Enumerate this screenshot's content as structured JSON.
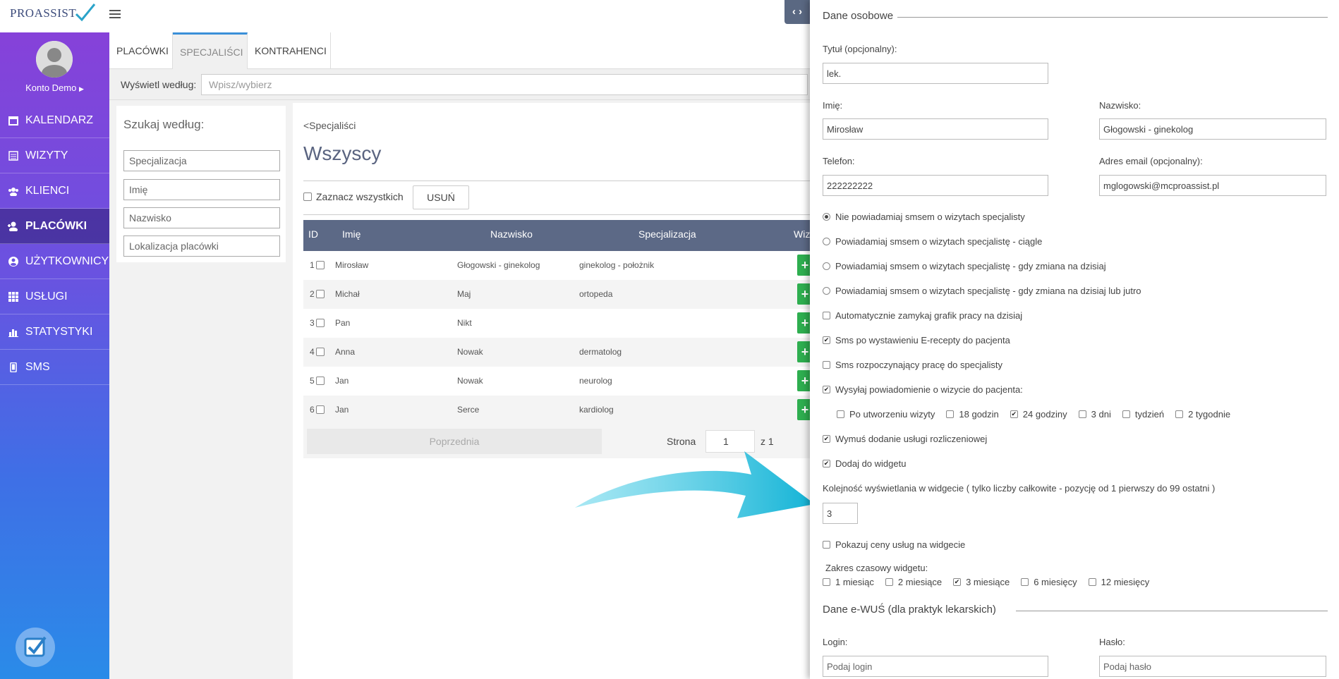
{
  "app": {
    "logo_text": "PROASSIST",
    "account_name": "Konto Demo"
  },
  "sidebar": {
    "items": [
      {
        "label": "KALENDARZ",
        "icon": "calendar-icon"
      },
      {
        "label": "WIZYTY",
        "icon": "list-icon"
      },
      {
        "label": "KLIENCI",
        "icon": "users-icon"
      },
      {
        "label": "PLACÓWKI",
        "icon": "user-plus-icon",
        "active": true
      },
      {
        "label": "UŻYTKOWNICY",
        "icon": "user-circle-icon"
      },
      {
        "label": "USŁUGI",
        "icon": "grid-icon"
      },
      {
        "label": "STATYSTYKI",
        "icon": "bar-chart-icon"
      },
      {
        "label": "SMS",
        "icon": "mobile-icon"
      }
    ]
  },
  "tabs": [
    "PLACÓWKI",
    "SPECJALIŚCI",
    "KONTRAHENCI"
  ],
  "filter": {
    "label": "Wyświetl według:",
    "placeholder": "Wpisz/wybierz"
  },
  "search": {
    "title": "Szukaj według:",
    "fields": [
      "Specjalizacja",
      "Imię",
      "Nazwisko",
      "Lokalizacja placówki"
    ]
  },
  "main": {
    "back_link": "<Specjaliści",
    "title": "Wszyscy",
    "select_all": "Zaznacz wszystkich",
    "delete_button": "USUŃ"
  },
  "table": {
    "columns": [
      "ID",
      "Imię",
      "Nazwisko",
      "Specjalizacja",
      "Wiz"
    ],
    "rows": [
      {
        "id": "1",
        "first": "Mirosław",
        "last": "Głogowski - ginekolog",
        "spec": "ginekolog - położnik"
      },
      {
        "id": "2",
        "first": "Michał",
        "last": "Maj",
        "spec": "ortopeda"
      },
      {
        "id": "3",
        "first": "Pan",
        "last": "Nikt",
        "spec": ""
      },
      {
        "id": "4",
        "first": "Anna",
        "last": "Nowak",
        "spec": "dermatolog"
      },
      {
        "id": "5",
        "first": "Jan",
        "last": "Nowak",
        "spec": "neurolog"
      },
      {
        "id": "6",
        "first": "Jan",
        "last": "Serce",
        "spec": "kardiolog"
      }
    ],
    "add_label": "+"
  },
  "pager": {
    "prev": "Poprzednia",
    "page_label": "Strona",
    "page_value": "1",
    "of": "z 1"
  },
  "panel": {
    "personal_title": "Dane osobowe",
    "title_label": "Tytuł (opcjonalny):",
    "title_value": "lek.",
    "first_label": "Imię:",
    "first_value": "Mirosław",
    "last_label": "Nazwisko:",
    "last_value": "Głogowski - ginekolog",
    "phone_label": "Telefon:",
    "phone_value": "222222222",
    "email_label": "Adres email (opcjonalny):",
    "email_value": "mglogowski@mcproassist.pl",
    "radios": [
      "Nie powiadamiaj smsem o wizytach specjalisty",
      "Powiadamiaj smsem o wizytach specjalistę - ciągle",
      "Powiadamiaj smsem o wizytach specjalistę - gdy zmiana na dzisiaj",
      "Powiadamiaj smsem o wizytach specjalistę - gdy zmiana na dzisiaj lub jutro"
    ],
    "check_autoclose": "Automatycznie zamykaj grafik pracy na dzisiaj",
    "check_erecepta": "Sms po wystawieniu E-recepty do pacjenta",
    "check_start": "Sms rozpoczynający pracę do specjalisty",
    "check_notify": "Wysyłaj powiadomienie o wizycie do pacjenta:",
    "notify_opts": [
      "Po utworzeniu wizyty",
      "18 godzin",
      "24 godziny",
      "3 dni",
      "tydzień",
      "2 tygodnie"
    ],
    "check_force": "Wymuś dodanie usługi rozliczeniowej",
    "check_widget": "Dodaj do widgetu",
    "order_label": "Kolejność wyświetlania w widgecie ( tylko liczby całkowite - pozycję od 1 pierwszy do 99 ostatni )",
    "order_value": "3",
    "check_prices": "Pokazuj ceny usług na widgecie",
    "range_label": "Zakres czasowy widgetu:",
    "range_opts": [
      "1 miesiąc",
      "2 miesiące",
      "3 miesiące",
      "6 miesięcy",
      "12 miesięcy"
    ],
    "ewus_title": "Dane e-WUŚ (dla praktyk lekarskich)",
    "login_label": "Login:",
    "login_placeholder": "Podaj login",
    "pass_label": "Hasło:",
    "pass_placeholder": "Podaj hasło"
  },
  "colors": {
    "sidebar_top": "#8a3fd8",
    "sidebar_bottom": "#2a8be8",
    "table_header": "#5c6986",
    "add_button": "#2eae4f",
    "arrow": "#1fb6d6"
  }
}
